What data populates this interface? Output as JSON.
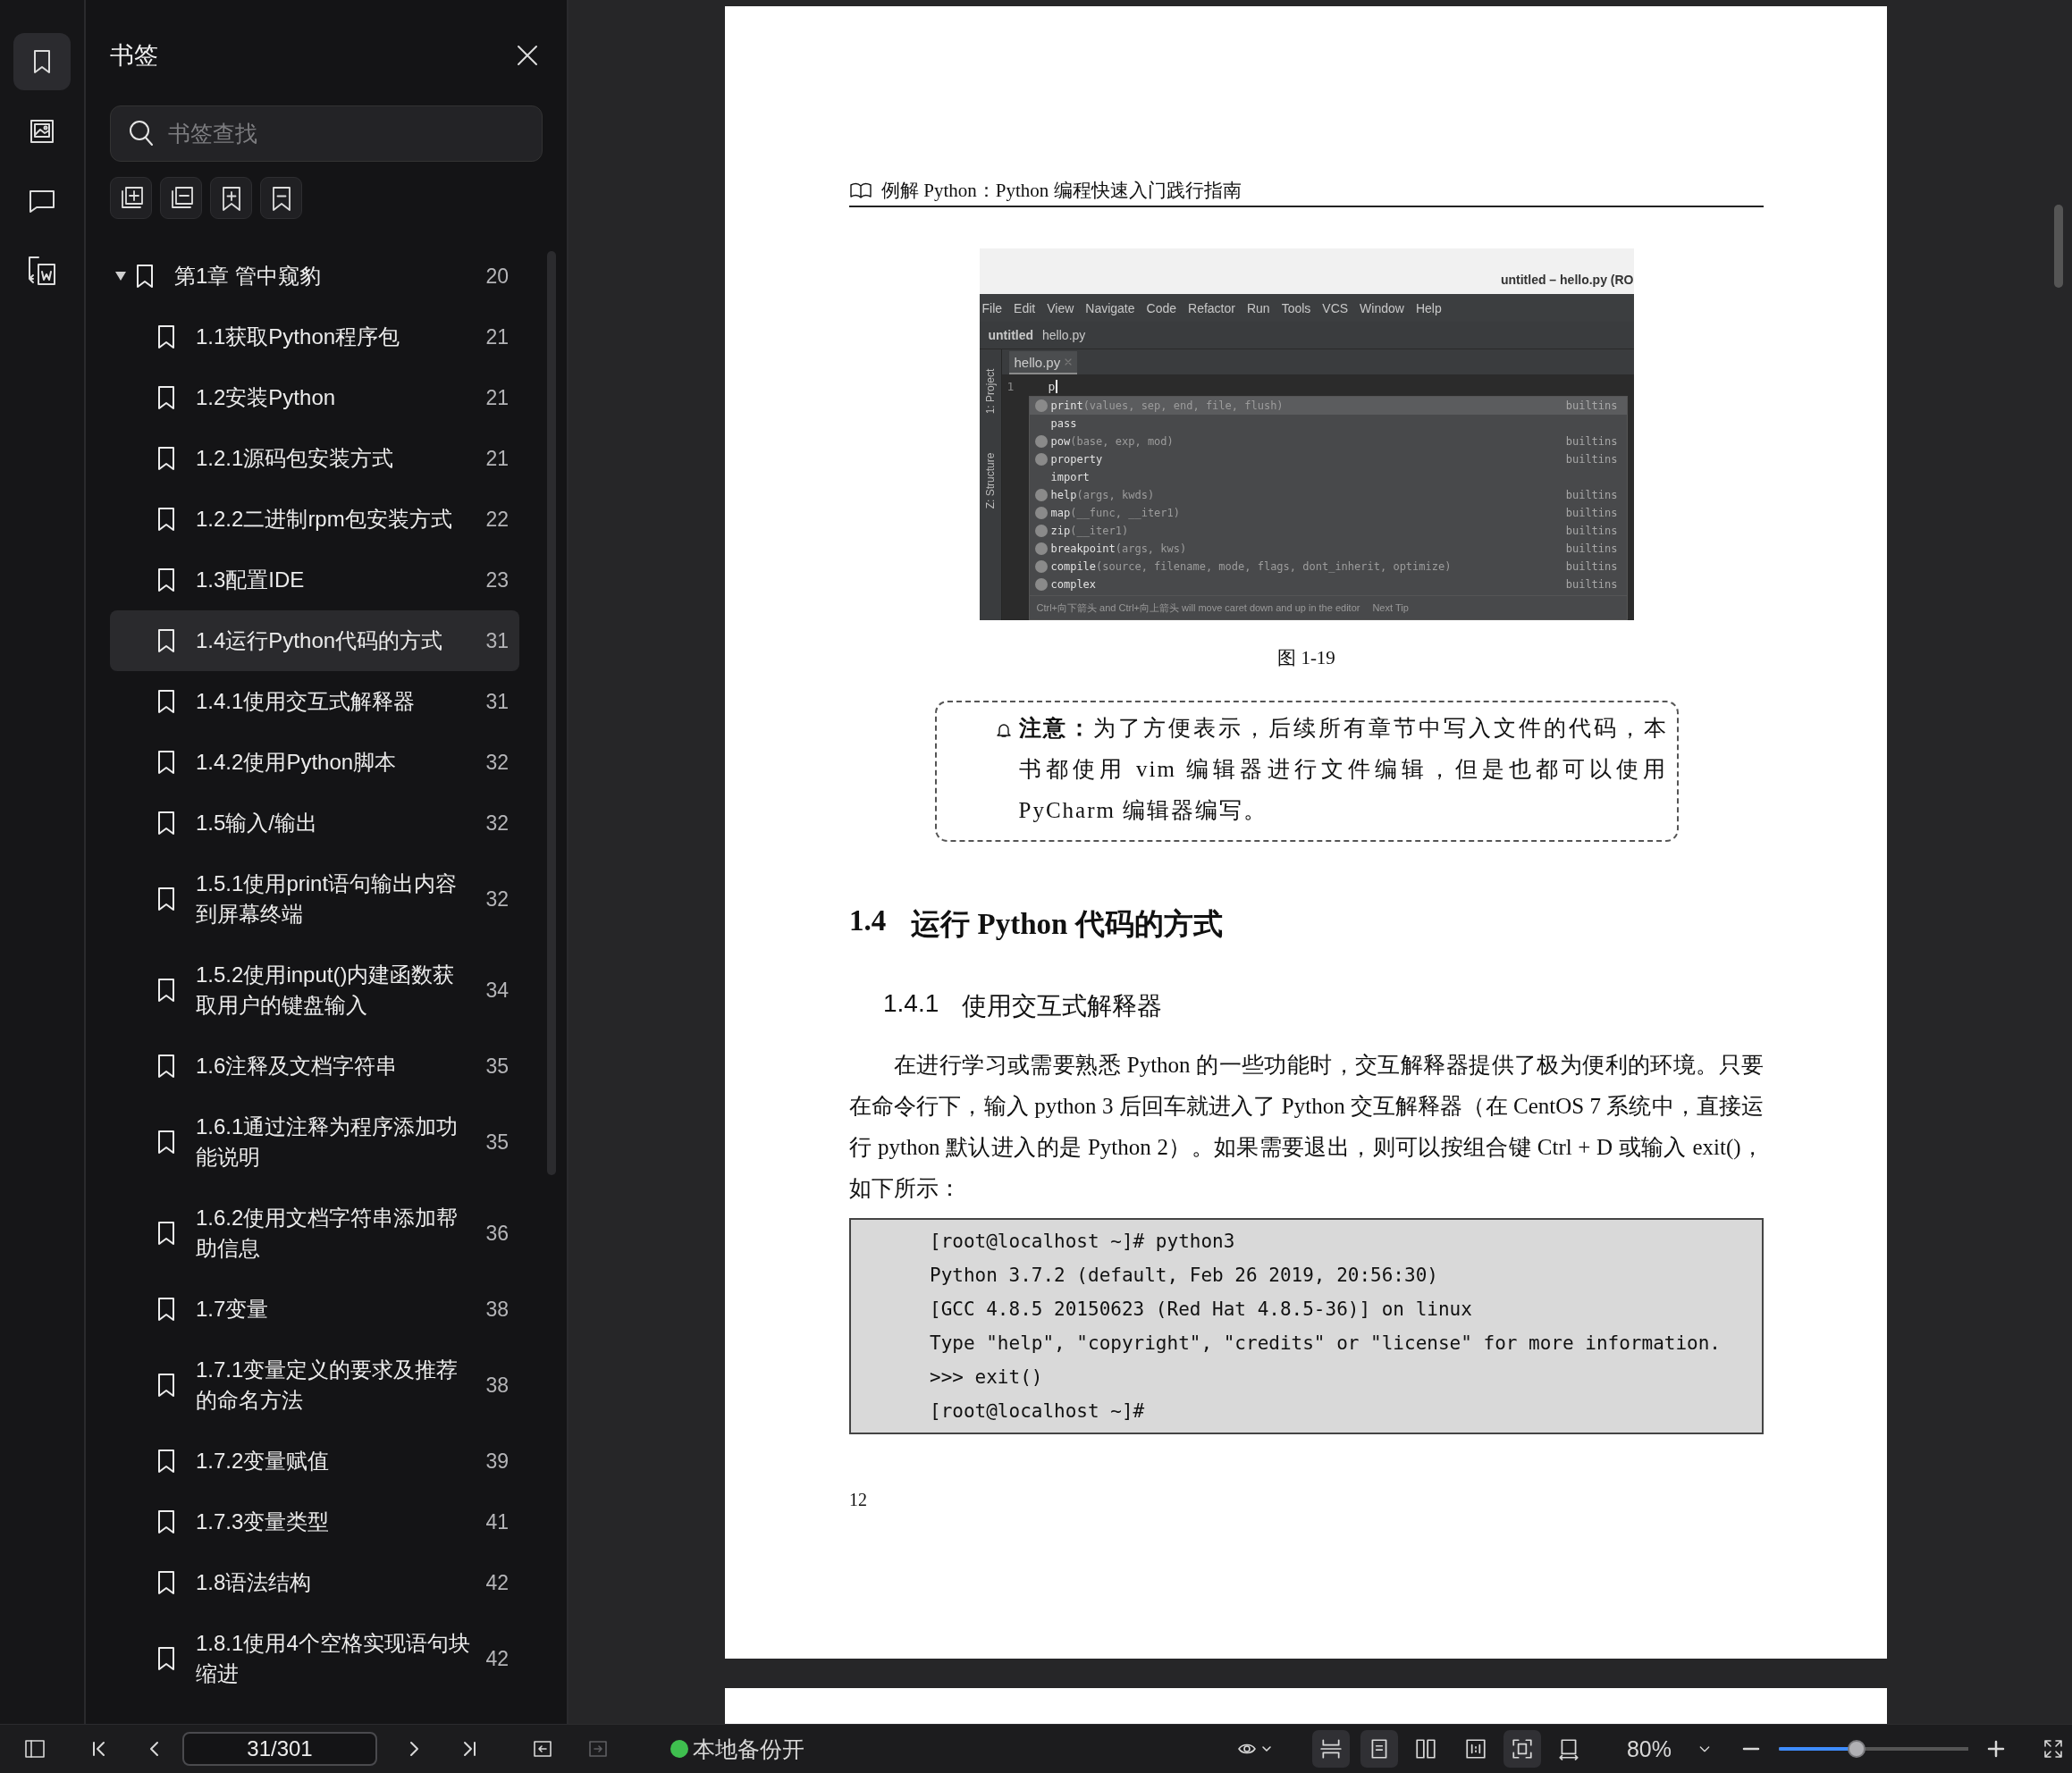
{
  "rail": [
    {
      "kind": "bookmarks",
      "selected": true
    },
    {
      "kind": "images",
      "selected": false
    },
    {
      "kind": "comments",
      "selected": false
    },
    {
      "kind": "export",
      "selected": false
    }
  ],
  "bookmark_panel": {
    "title": "书签",
    "search": {
      "placeholder": "书签查找"
    },
    "tools": [
      {
        "kind": "expand-all"
      },
      {
        "kind": "collapse-all"
      },
      {
        "kind": "add"
      },
      {
        "kind": "remove"
      }
    ],
    "items": [
      {
        "label": "第1章  管中窥豹",
        "page": "20",
        "expanded": true,
        "selected": false,
        "children": [
          {
            "label": "1.1获取Python程序包",
            "page": "21",
            "selected": false
          },
          {
            "label": "1.2安装Python",
            "page": "21",
            "selected": false
          },
          {
            "label": "1.2.1源码包安装方式",
            "page": "21",
            "selected": false
          },
          {
            "label": "1.2.2二进制rpm包安装方式",
            "page": "22",
            "selected": false
          },
          {
            "label": "1.3配置IDE",
            "page": "23",
            "selected": false
          },
          {
            "label": "1.4运行Python代码的方式",
            "page": "31",
            "selected": true
          },
          {
            "label": "1.4.1使用交互式解释器",
            "page": "31",
            "selected": false
          },
          {
            "label": "1.4.2使用Python脚本",
            "page": "32",
            "selected": false
          },
          {
            "label": "1.5输入/输出",
            "page": "32",
            "selected": false
          },
          {
            "label": "1.5.1使用print语句输出内容到屏幕终端",
            "page": "32",
            "selected": false
          },
          {
            "label": "1.5.2使用input()内建函数获取用户的键盘输入",
            "page": "34",
            "selected": false
          },
          {
            "label": "1.6注释及文档字符串",
            "page": "35",
            "selected": false
          },
          {
            "label": "1.6.1通过注释为程序添加功能说明",
            "page": "35",
            "selected": false
          },
          {
            "label": "1.6.2使用文档字符串添加帮助信息",
            "page": "36",
            "selected": false
          },
          {
            "label": "1.7变量",
            "page": "38",
            "selected": false
          },
          {
            "label": "1.7.1变量定义的要求及推荐的命名方法",
            "page": "38",
            "selected": false
          },
          {
            "label": "1.7.2变量赋值",
            "page": "39",
            "selected": false
          },
          {
            "label": "1.7.3变量类型",
            "page": "41",
            "selected": false
          },
          {
            "label": "1.8语法结构",
            "page": "42",
            "selected": false
          },
          {
            "label": "1.8.1使用4个空格实现语句块缩进",
            "page": "42",
            "selected": false
          }
        ]
      }
    ]
  },
  "document": {
    "running_header": "例解 Python：Python 编程快速入门践行指南",
    "figure": {
      "ide": {
        "title": "untitled – hello.py (RO",
        "menu": [
          "File",
          "Edit",
          "View",
          "Navigate",
          "Code",
          "Refactor",
          "Run",
          "Tools",
          "VCS",
          "Window",
          "Help"
        ],
        "breadcrumb": [
          "untitled",
          "hello.py"
        ],
        "side_tabs": [
          "1: Project",
          "Z: Structure"
        ],
        "tab": "hello.py",
        "line_number": "1",
        "typed": "p",
        "completions": [
          {
            "kind": "function",
            "name": "print",
            "args": "(values, sep, end, file, flush)",
            "source": "builtins",
            "selected": true
          },
          {
            "kind": "keyword",
            "name": "pass",
            "selected": false
          },
          {
            "kind": "function",
            "name": "pow",
            "args": "(base, exp, mod)",
            "source": "builtins",
            "selected": false
          },
          {
            "kind": "class",
            "name": "property",
            "source": "builtins",
            "selected": false
          },
          {
            "kind": "keyword",
            "name": "import",
            "selected": false
          },
          {
            "kind": "function",
            "name": "help",
            "args": "(args, kwds)",
            "source": "builtins",
            "selected": false
          },
          {
            "kind": "function",
            "name": "map",
            "args": "(__func, __iter1)",
            "source": "builtins",
            "selected": false
          },
          {
            "kind": "function",
            "name": "zip",
            "args": "(__iter1)",
            "source": "builtins",
            "selected": false
          },
          {
            "kind": "function",
            "name": "breakpoint",
            "args": "(args, kws)",
            "source": "builtins",
            "selected": false
          },
          {
            "kind": "function",
            "name": "compile",
            "args": "(source, filename, mode, flags, dont_inherit, optimize)",
            "source": "builtins",
            "selected": false
          },
          {
            "kind": "class",
            "name": "complex",
            "source": "builtins",
            "selected": false
          }
        ],
        "tip": "Ctrl+向下箭头 and Ctrl+向上箭头 will move caret down and up in the editor",
        "tip_link": "Next Tip"
      },
      "caption": "图 1-19"
    },
    "note": "**注意：**为了方便表示，后续所有章节中写入文件的代码，本书都使用 vim 编辑器进行文件编辑，但是也都可以使用 PyCharm 编辑器编写。",
    "heading": {
      "number": "1.4",
      "title": "运行 Python 代码的方式"
    },
    "subheading": {
      "number": "1.4.1",
      "title": "使用交互式解释器"
    },
    "paragraph": "在进行学习或需要熟悉 Python 的一些功能时，交互解释器提供了极为便利的环境。只要在命令行下，输入 python 3 后回车就进入了 Python 交互解释器（在 CentOS 7 系统中，直接运行 python 默认进入的是 Python 2）。如果需要退出，则可以按组合键 Ctrl + D 或输入 exit()，如下所示：",
    "code": [
      "[root@localhost ~]# python3",
      "Python 3.7.2 (default, Feb 26 2019, 20:56:30)",
      "[GCC 4.8.5 20150623 (Red Hat 4.8.5-36)] on linux",
      "Type \"help\", \"copyright\", \"credits\" or \"license\" for more information.",
      ">>> exit()",
      "[root@localhost ~]#"
    ],
    "page_number": "12"
  },
  "status_bar": {
    "page_field": {
      "value": "31/301"
    },
    "history": [
      {
        "kind": "back",
        "disabled": false
      },
      {
        "kind": "forward",
        "disabled": true
      }
    ],
    "backup": {
      "label": "本地备份开",
      "on": true
    },
    "view_buttons": [
      {
        "kind": "continuous",
        "selected": true
      },
      {
        "kind": "single-page",
        "selected": true
      },
      {
        "kind": "two-page",
        "selected": false
      },
      {
        "kind": "actual-size",
        "selected": false
      },
      {
        "kind": "fit-page",
        "selected": true
      },
      {
        "kind": "fit-width",
        "selected": false
      }
    ],
    "zoom": {
      "value": "80%",
      "level": 0.41
    }
  }
}
